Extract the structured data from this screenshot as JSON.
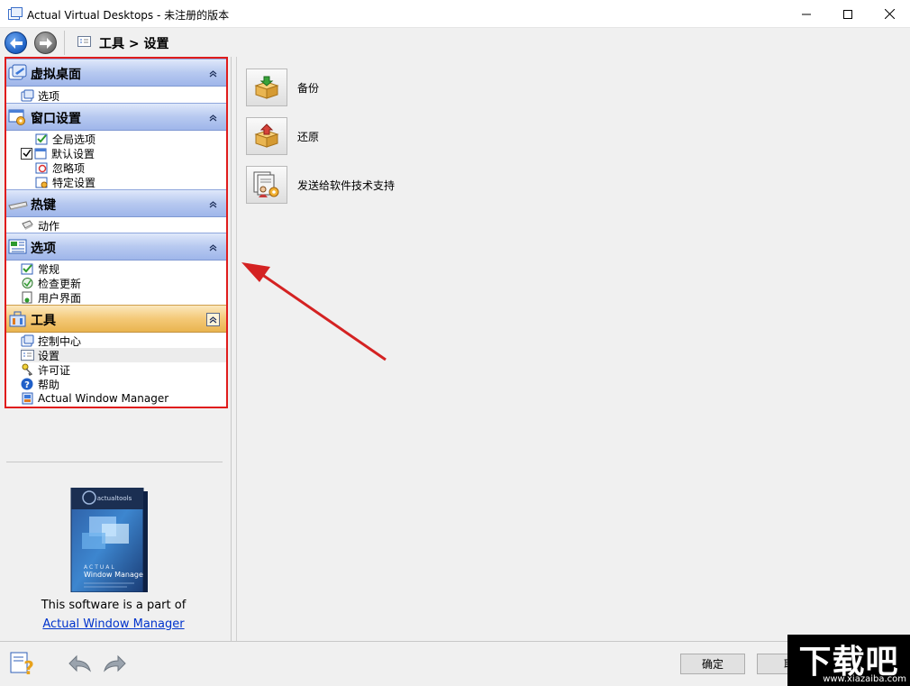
{
  "window": {
    "title": "Actual Virtual Desktops - 未注册的版本"
  },
  "toolbar": {
    "breadcrumb": "工具 > 设置"
  },
  "nav_groups": [
    {
      "label": "虚拟桌面",
      "icon": "virtual-desktop-icon",
      "items": [
        {
          "label": "选项",
          "icon": "options-icon"
        }
      ]
    },
    {
      "label": "窗口设置",
      "icon": "window-settings-icon",
      "items": [
        {
          "label": "全局选项",
          "icon": "global-options-icon"
        },
        {
          "label": "默认设置",
          "icon": "default-settings-icon",
          "checked": true
        },
        {
          "label": "忽略项",
          "icon": "ignore-icon"
        },
        {
          "label": "特定设置",
          "icon": "specific-settings-icon"
        }
      ]
    },
    {
      "label": "热键",
      "icon": "hotkey-icon",
      "items": [
        {
          "label": "动作",
          "icon": "action-icon"
        }
      ]
    },
    {
      "label": "选项",
      "icon": "options-group-icon",
      "items": [
        {
          "label": "常规",
          "icon": "general-icon"
        },
        {
          "label": "检查更新",
          "icon": "check-update-icon"
        },
        {
          "label": "用户界面",
          "icon": "user-interface-icon"
        }
      ]
    },
    {
      "label": "工具",
      "icon": "tools-icon",
      "active": true,
      "items": [
        {
          "label": "控制中心",
          "icon": "control-center-icon"
        },
        {
          "label": "设置",
          "icon": "settings-icon",
          "selected": true
        },
        {
          "label": "许可证",
          "icon": "license-icon"
        },
        {
          "label": "帮助",
          "icon": "help-icon"
        },
        {
          "label": "Actual Window Manager",
          "icon": "window-manager-icon"
        }
      ]
    }
  ],
  "promo": {
    "box_brand": "actualtools",
    "box_product_line1": "ACTUAL",
    "box_product_line2": "Window Manager",
    "text": "This software is a part of",
    "link": "Actual Window Manager"
  },
  "actions": [
    {
      "label": "备份",
      "icon": "backup-icon"
    },
    {
      "label": "还原",
      "icon": "restore-icon"
    },
    {
      "label": "发送给软件技术支持",
      "icon": "send-support-icon"
    }
  ],
  "footer": {
    "ok_label": "确定",
    "cancel_label_visible": "取"
  },
  "watermark": {
    "main": "下载吧",
    "url": "www.xiazaiba.com"
  },
  "colors": {
    "highlight_outline": "#e01c1c",
    "annotation_arrow": "#d42222",
    "group_header": "#b7c9f0",
    "group_header_active": "#f4c978",
    "link": "#0033cc"
  }
}
